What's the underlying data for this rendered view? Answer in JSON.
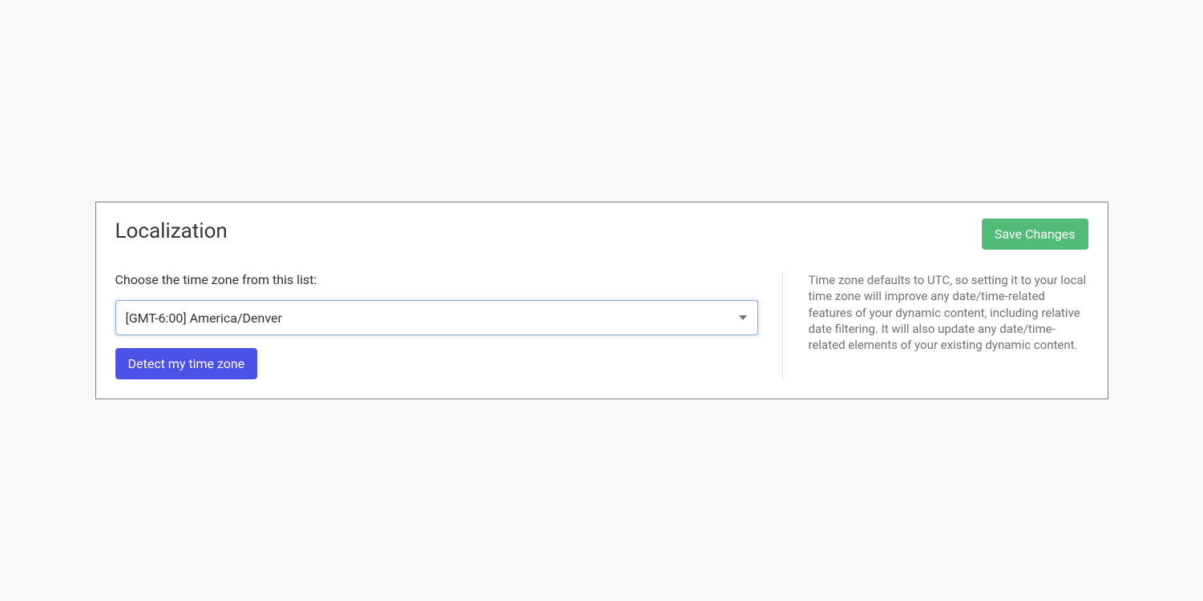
{
  "card": {
    "title": "Localization",
    "save_label": "Save Changes"
  },
  "timezone": {
    "label": "Choose the time zone from this list:",
    "selected_value": "[GMT-6:00] America/Denver",
    "detect_label": "Detect my time zone",
    "help_text": "Time zone defaults to UTC, so setting it to your local time zone will improve any date/time-related features of your dynamic content, including relative date filtering. It will also update any date/time-related elements of your existing dynamic content."
  }
}
